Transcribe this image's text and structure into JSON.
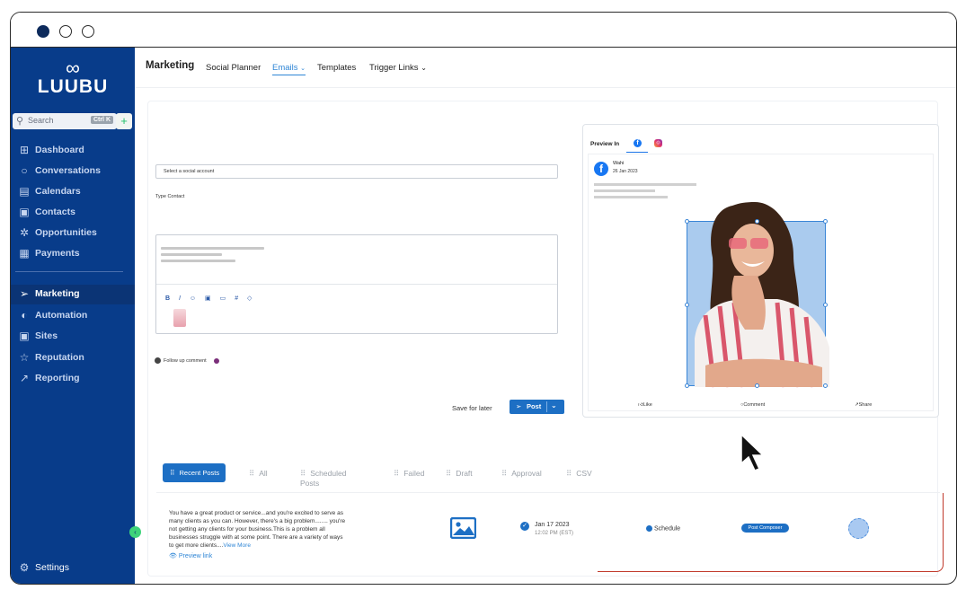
{
  "window": {
    "controls": [
      "close-dot",
      "minimize-dot",
      "maximize-dot"
    ]
  },
  "sidebar": {
    "logo_text": "LUUBU",
    "search_placeholder": "Search",
    "search_shortcut": "Ctrl K",
    "items": [
      {
        "label": "Dashboard",
        "icon": "dashboard-icon"
      },
      {
        "label": "Conversations",
        "icon": "chat-icon"
      },
      {
        "label": "Calendars",
        "icon": "calendar-icon"
      },
      {
        "label": "Contacts",
        "icon": "contacts-icon"
      },
      {
        "label": "Opportunities",
        "icon": "opportunities-icon"
      },
      {
        "label": "Payments",
        "icon": "payments-icon"
      },
      {
        "label": "Marketing",
        "icon": "marketing-icon",
        "active": true
      },
      {
        "label": "Automation",
        "icon": "automation-icon"
      },
      {
        "label": "Sites",
        "icon": "sites-icon"
      },
      {
        "label": "Reputation",
        "icon": "star-icon"
      },
      {
        "label": "Reporting",
        "icon": "reporting-icon"
      }
    ],
    "settings_label": "Settings"
  },
  "topnav": {
    "title": "Marketing",
    "tabs": [
      "Social Planner",
      "Emails",
      "Templates",
      "Trigger Links"
    ],
    "active_tab": "Emails"
  },
  "composer": {
    "account_placeholder": "Select a social account",
    "type_label": "Type Contact",
    "toolbar": [
      "B",
      "I",
      "☺",
      "▣",
      "▭",
      "#",
      "◇"
    ],
    "follow_up_label": "Follow up comment",
    "save_for_later": "Save for later",
    "post_label": "Post"
  },
  "preview": {
    "label": "Preview In",
    "author": "Wahi",
    "date": "26 Jan 2023",
    "actions": [
      "Like",
      "Comment",
      "Share"
    ]
  },
  "posts": {
    "tabs": [
      "Recent Posts",
      "All",
      "Scheduled Posts",
      "Failed",
      "Draft",
      "Approval",
      "CSV"
    ],
    "active_tab": "Recent Posts",
    "rows": [
      {
        "text": "You have a great product or service...and you're excited to serve as many clients as you can. However, there's a big problem........ you're not getting any clients for your business.This is a problem all businesses struggle with at some point. There are a variety of ways to get more clients....",
        "view_more": "View More",
        "preview_link": "Preview link",
        "date": "Jan 17 2023",
        "time": "12:02 PM (EST)",
        "status": "Schedule",
        "source": "Post Composer"
      }
    ]
  },
  "colors": {
    "sidebar_bg": "#083c8a",
    "accent": "#1d6fc4",
    "active_link": "#2f86d6"
  }
}
